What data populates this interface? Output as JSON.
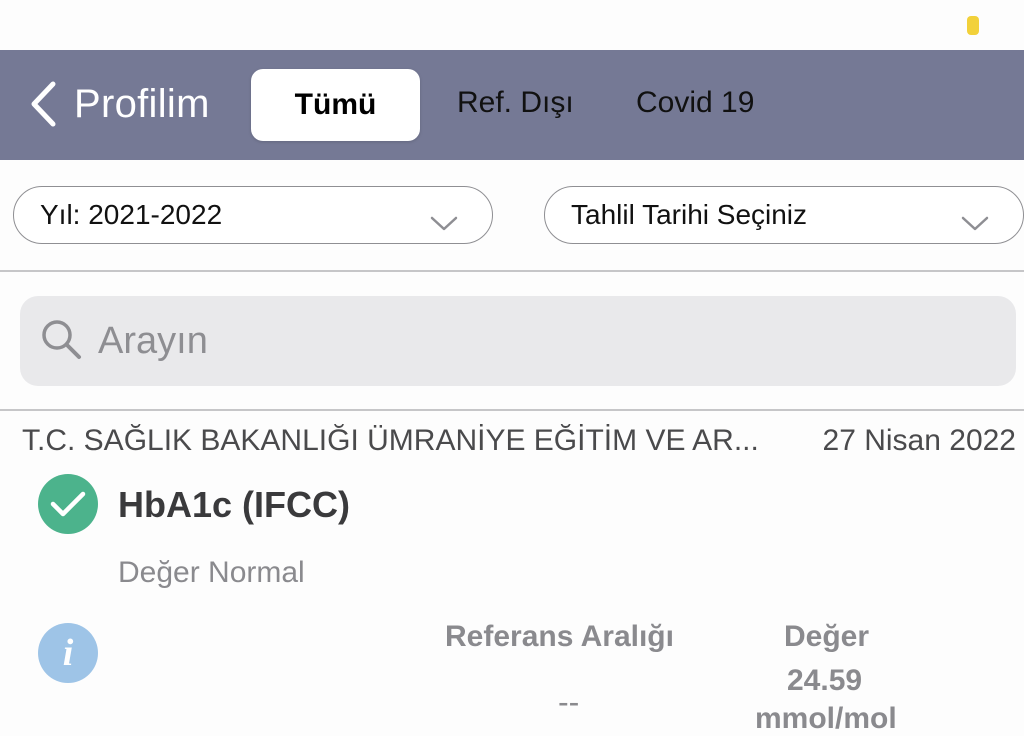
{
  "colors": {
    "navbar_bg": "#757995",
    "check_green": "#4cb38c",
    "info_blue": "#9ec4e7",
    "battery_yellow": "#f2d13a"
  },
  "nav": {
    "back_label": "Profilim",
    "back_icon": "chevron-left-icon",
    "tabs": [
      {
        "label": "Tümü",
        "selected": true
      },
      {
        "label": "Ref. Dışı",
        "selected": false
      },
      {
        "label": "Covid 19",
        "selected": false
      }
    ]
  },
  "filters": {
    "year": "Yıl: 2021-2022",
    "date": "Tahlil Tarihi Seçiniz"
  },
  "search": {
    "placeholder": "Arayın",
    "icon": "search-icon"
  },
  "result": {
    "lab": "T.C. SAĞLIK BAKANLIĞI ÜMRANİYE EĞİTİM VE AR...",
    "date": "27 Nisan 2022",
    "test_name": "HbA1c (IFCC)",
    "status": "Değer Normal",
    "reference_header": "Referans Aralığı",
    "reference_value": "--",
    "value_header": "Değer",
    "value": "24.59",
    "unit": "mmol/mol"
  }
}
